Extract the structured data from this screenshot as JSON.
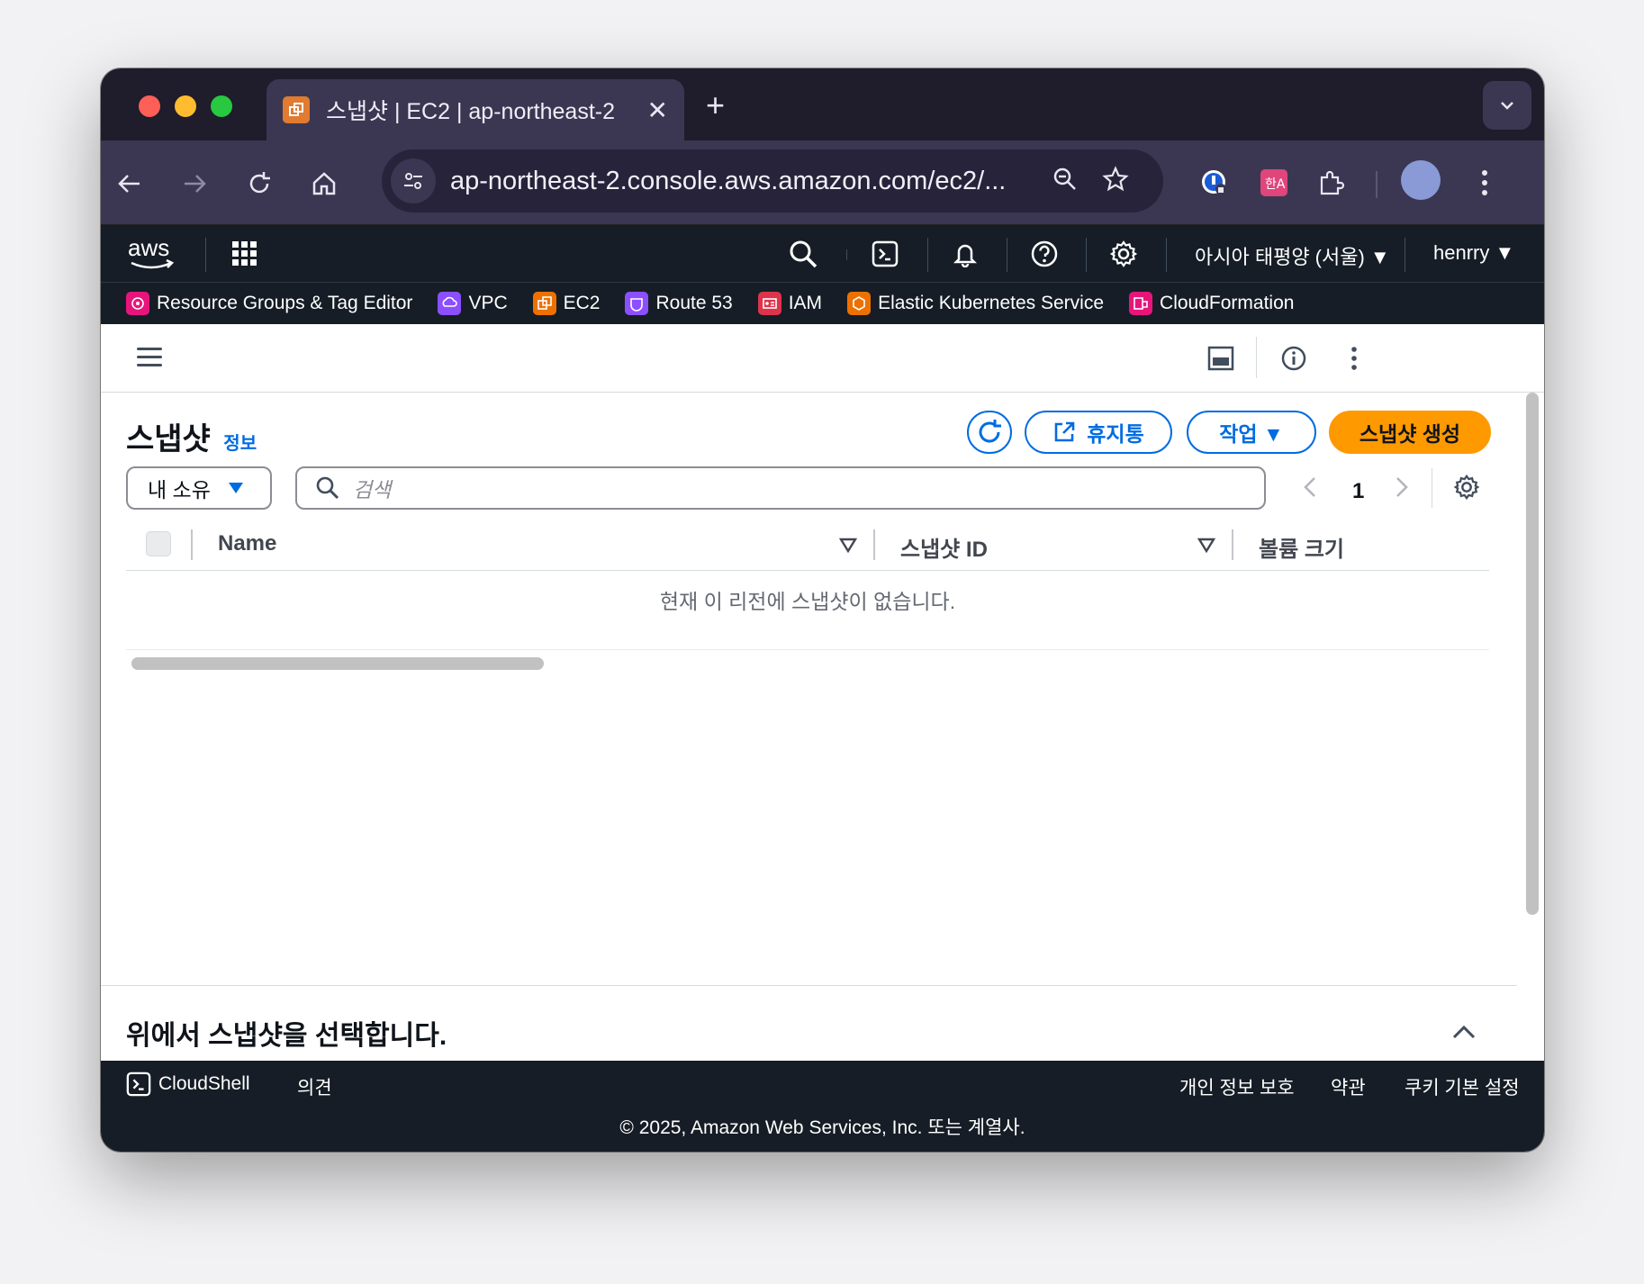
{
  "browser": {
    "tab_title": "스냅샷 | EC2 | ap-northeast-2",
    "url": "ap-northeast-2.console.aws.amazon.com/ec2/..."
  },
  "aws_header": {
    "region": "아시아 태평양 (서울) ▼",
    "user": "henrry ▼"
  },
  "favorites": [
    {
      "label": "Resource Groups & Tag Editor",
      "color": "#e7157b"
    },
    {
      "label": "VPC",
      "color": "#8c4fff"
    },
    {
      "label": "EC2",
      "color": "#ed7100"
    },
    {
      "label": "Route 53",
      "color": "#8c4fff"
    },
    {
      "label": "IAM",
      "color": "#dd344c"
    },
    {
      "label": "Elastic Kubernetes Service",
      "color": "#ed7100"
    },
    {
      "label": "CloudFormation",
      "color": "#e7157b"
    }
  ],
  "page": {
    "title": "스냅샷",
    "info": "정보",
    "recycle_bin": "휴지통",
    "actions": "작업 ▼",
    "create": "스냅샷 생성",
    "filter": "내 소유",
    "search_placeholder": "검색",
    "page_number": "1"
  },
  "table": {
    "columns": [
      "Name",
      "스냅샷 ID",
      "볼륨 크기"
    ],
    "empty_message": "현재 이 리전에 스냅샷이 없습니다."
  },
  "split_panel": {
    "title": "위에서 스냅샷을 선택합니다."
  },
  "footer": {
    "cloudshell": "CloudShell",
    "feedback": "의견",
    "privacy": "개인 정보 보호",
    "terms": "약관",
    "cookies": "쿠키 기본 설정",
    "copyright": "© 2025, Amazon Web Services, Inc. 또는 계열사."
  },
  "colors": {
    "accent": "#006ce0",
    "primary_button": "#ff9900",
    "header_bg": "#161d26"
  }
}
